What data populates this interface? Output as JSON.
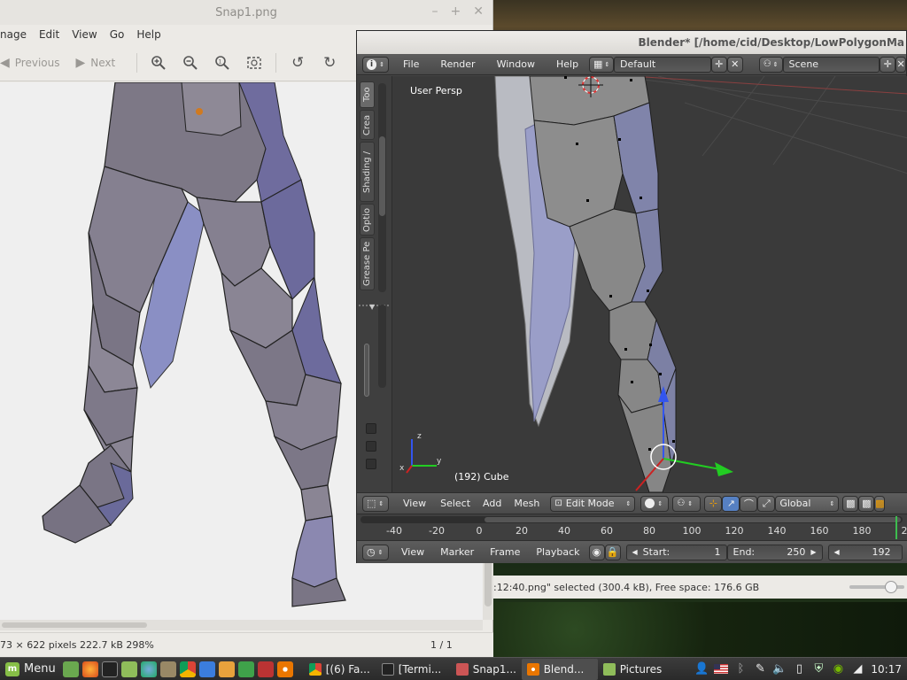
{
  "viewer": {
    "title": "Snap1.png",
    "win_buttons": [
      "–",
      "+",
      "✕"
    ],
    "menu": [
      "nage",
      "Edit",
      "View",
      "Go",
      "Help"
    ],
    "toolbar": {
      "previous": "Previous",
      "next": "Next"
    },
    "status_left": "73 × 622 pixels  222.7 kB  298%",
    "status_right": "1 / 1"
  },
  "blender": {
    "title": "Blender* [/home/cid/Desktop/LowPolygonMa",
    "info_menu": [
      "File",
      "Render",
      "Window",
      "Help"
    ],
    "screen_layout": "Default",
    "scene": "Scene",
    "tool_tabs": [
      "Too",
      "Crea",
      "Shading /",
      "Optio",
      "Grease Pe"
    ],
    "viewport_label": "User Persp",
    "object_label": "(192) Cube",
    "axis_x": "x",
    "axis_y": "y",
    "axis_z": "z",
    "vp_menu": [
      "View",
      "Select",
      "Add",
      "Mesh"
    ],
    "mode": "Edit Mode",
    "orientation": "Global",
    "timeline_ticks": [
      "-40",
      "-20",
      "0",
      "20",
      "40",
      "60",
      "80",
      "100",
      "120",
      "140",
      "160",
      "180",
      "2"
    ],
    "timeline_menu": [
      "View",
      "Marker",
      "Frame",
      "Playback"
    ],
    "start_label": "Start:",
    "start_value": "1",
    "end_label": "End:",
    "end_value": "250",
    "current_frame": "192"
  },
  "filemanager": {
    "status": ":12:40.png\" selected (300.4 kB), Free space: 176.6 GB"
  },
  "taskbar": {
    "menu_label": "Menu",
    "tasks": [
      "[(6) Fa...",
      "[Termi...",
      "Snap1...",
      "Blend...",
      "Pictures"
    ],
    "clock": "10:17"
  },
  "colors": {
    "blender_panel": "#454545",
    "viewer_bg": "#eceae6",
    "mesh_gray": "#8a8a8a",
    "mesh_blue": "#8a8fc0",
    "taskbar": "#2f2f2f"
  }
}
